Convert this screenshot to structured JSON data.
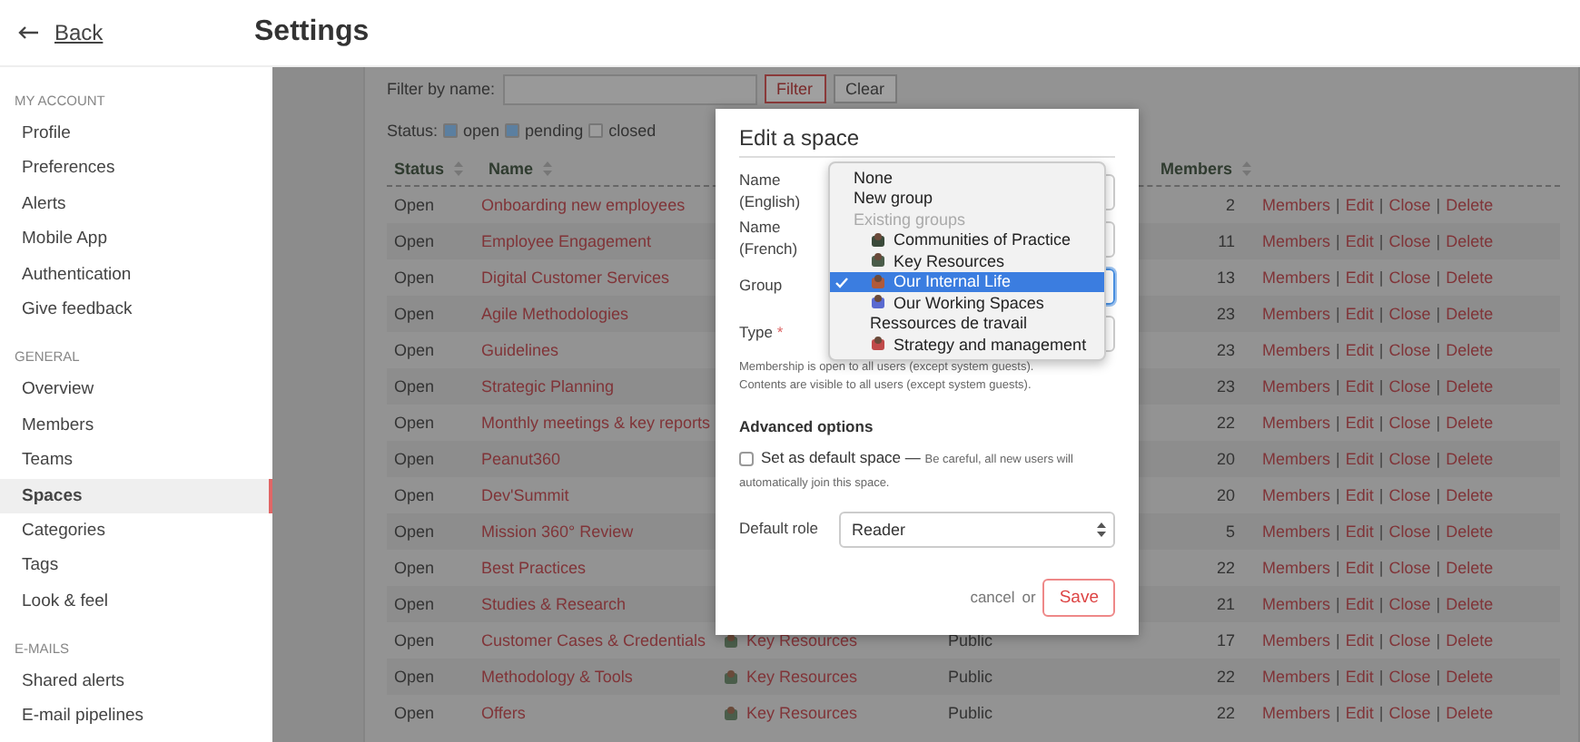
{
  "header": {
    "back": "Back",
    "title": "Settings"
  },
  "sidebar": {
    "sections": [
      {
        "label": "MY ACCOUNT",
        "items": [
          {
            "label": "Profile",
            "selected": false
          },
          {
            "label": "Preferences",
            "selected": false
          },
          {
            "label": "Alerts",
            "selected": false
          },
          {
            "label": "Mobile App",
            "selected": false
          },
          {
            "label": "Authentication",
            "selected": false
          },
          {
            "label": "Give feedback",
            "selected": false
          }
        ]
      },
      {
        "label": "GENERAL",
        "items": [
          {
            "label": "Overview",
            "selected": false
          },
          {
            "label": "Members",
            "selected": false
          },
          {
            "label": "Teams",
            "selected": false
          },
          {
            "label": "Spaces",
            "selected": true
          },
          {
            "label": "Categories",
            "selected": false
          },
          {
            "label": "Tags",
            "selected": false
          },
          {
            "label": "Look & feel",
            "selected": false
          }
        ]
      },
      {
        "label": "E-MAILS",
        "items": [
          {
            "label": "Shared alerts",
            "selected": false
          },
          {
            "label": "E-mail pipelines",
            "selected": false
          }
        ]
      }
    ]
  },
  "filter": {
    "label": "Filter by name:",
    "buttons": [
      "Filter",
      "Clear"
    ],
    "status_label": "Status:",
    "statuses": [
      {
        "label": "open",
        "checked": true
      },
      {
        "label": "pending",
        "checked": true
      },
      {
        "label": "closed",
        "checked": false
      }
    ]
  },
  "table": {
    "columns": [
      "Status",
      "Name",
      "Members"
    ],
    "rows": [
      {
        "status": "Open",
        "name": "Onboarding new employees",
        "members": "2",
        "separator": "|",
        "actions": [
          "Members",
          "Edit",
          "Close",
          "Delete"
        ]
      },
      {
        "status": "Open",
        "name": "Employee Engagement",
        "members": "11",
        "separator": "|",
        "actions": [
          "Members",
          "Edit",
          "Close",
          "Delete"
        ]
      },
      {
        "status": "Open",
        "name": "Digital Customer Services",
        "members": "13",
        "separator": "|",
        "actions": [
          "Members",
          "Edit",
          "Close",
          "Delete"
        ]
      },
      {
        "status": "Open",
        "name": "Agile Methodologies",
        "members": "23",
        "separator": "|",
        "actions": [
          "Members",
          "Edit",
          "Close",
          "Delete"
        ]
      },
      {
        "status": "Open",
        "name": "Guidelines",
        "members": "23",
        "separator": "|",
        "actions": [
          "Members",
          "Edit",
          "Close",
          "Delete"
        ]
      },
      {
        "status": "Open",
        "name": "Strategic Planning",
        "members": "23",
        "separator": "|",
        "actions": [
          "Members",
          "Edit",
          "Close",
          "Delete"
        ]
      },
      {
        "status": "Open",
        "name": "Monthly meetings & key reports",
        "members": "22",
        "separator": "|",
        "actions": [
          "Members",
          "Edit",
          "Close",
          "Delete"
        ]
      },
      {
        "status": "Open",
        "name": "Peanut360",
        "members": "20",
        "separator": "|",
        "actions": [
          "Members",
          "Edit",
          "Close",
          "Delete"
        ]
      },
      {
        "status": "Open",
        "name": "Dev'Summit",
        "members": "20",
        "separator": "|",
        "actions": [
          "Members",
          "Edit",
          "Close",
          "Delete"
        ]
      },
      {
        "status": "Open",
        "name": "Mission 360° Review",
        "members": "5",
        "separator": "|",
        "actions": [
          "Members",
          "Edit",
          "Close",
          "Delete"
        ]
      },
      {
        "status": "Open",
        "name": "Best Practices",
        "members": "22",
        "separator": "|",
        "actions": [
          "Members",
          "Edit",
          "Close",
          "Delete"
        ]
      },
      {
        "status": "Open",
        "name": "Studies & Research",
        "members": "21",
        "separator": "|",
        "actions": [
          "Members",
          "Edit",
          "Close",
          "Delete"
        ]
      },
      {
        "status": "Open",
        "name": "Customer Cases & Credentials",
        "group": "Key Resources",
        "type": "Public",
        "members": "17",
        "separator": "|",
        "actions": [
          "Members",
          "Edit",
          "Close",
          "Delete"
        ]
      },
      {
        "status": "Open",
        "name": "Methodology & Tools",
        "group": "Key Resources",
        "type": "Public",
        "members": "22",
        "separator": "|",
        "actions": [
          "Members",
          "Edit",
          "Close",
          "Delete"
        ]
      },
      {
        "status": "Open",
        "name": "Offers",
        "group": "Key Resources",
        "type": "Public",
        "members": "22",
        "separator": "|",
        "actions": [
          "Members",
          "Edit",
          "Close",
          "Delete"
        ]
      }
    ]
  },
  "modal": {
    "title": "Edit a space",
    "fields": [
      {
        "label": "Name (English)",
        "kind": "input"
      },
      {
        "label": "Name (French)",
        "kind": "input"
      },
      {
        "label": "Group",
        "kind": "select",
        "expanded": true
      },
      {
        "label": "Type",
        "kind": "select",
        "required": "*"
      }
    ],
    "group_options": [
      {
        "label": "None",
        "kind": "plain",
        "selected": false
      },
      {
        "label": "New group",
        "kind": "plain",
        "selected": false
      },
      {
        "label": "Existing groups",
        "kind": "header",
        "selected": false
      },
      {
        "label": "Communities of Practice",
        "kind": "icon",
        "selected": false
      },
      {
        "label": "Key Resources",
        "kind": "icon",
        "selected": false
      },
      {
        "label": "Our Internal Life",
        "kind": "icon",
        "selected": true
      },
      {
        "label": "Our Working Spaces",
        "kind": "icon",
        "selected": false
      },
      {
        "label": "Ressources de travail",
        "kind": "sub",
        "selected": false
      },
      {
        "label": "Strategy and management",
        "kind": "icon",
        "selected": false
      }
    ],
    "help": [
      "Membership is open to all users (except system guests).",
      "Contents are visible to all users (except system guests)."
    ],
    "advanced_title": "Advanced options",
    "default_space": {
      "label": "Set as default space —",
      "note": "Be careful, all new users will automatically join this space.",
      "checked": false
    },
    "default_role": {
      "label": "Default role",
      "value": "Reader"
    },
    "cancel": "cancel",
    "or": "or",
    "save": "Save"
  }
}
